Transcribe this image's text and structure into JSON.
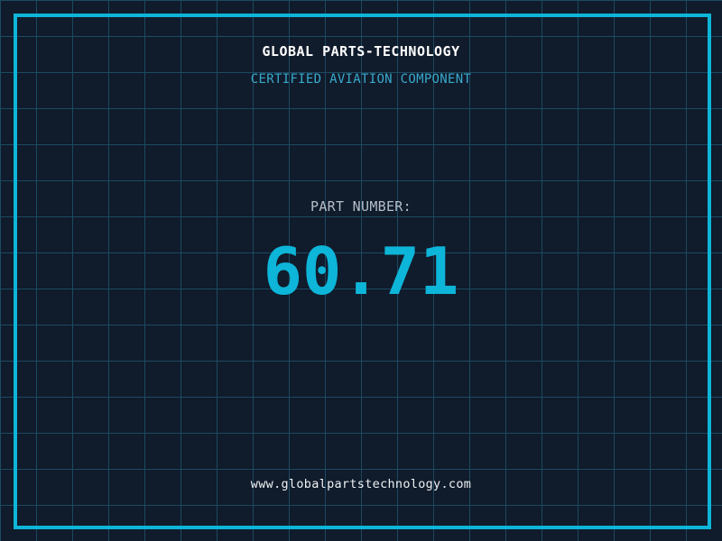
{
  "header": {
    "title": "GLOBAL PARTS-TECHNOLOGY",
    "subtitle": "CERTIFIED AVIATION COMPONENT"
  },
  "part": {
    "label": "PART NUMBER:",
    "value": "60.71"
  },
  "footer": {
    "url": "www.globalpartstechnology.com"
  },
  "colors": {
    "background": "#101b2b",
    "grid_line": "#1c4a61",
    "frame": "#0db5d8",
    "title": "#ffffff",
    "subtitle": "#39a9cc",
    "label": "#b5bfc9",
    "part_number": "#0db5d8",
    "footer": "#eef2f5"
  }
}
